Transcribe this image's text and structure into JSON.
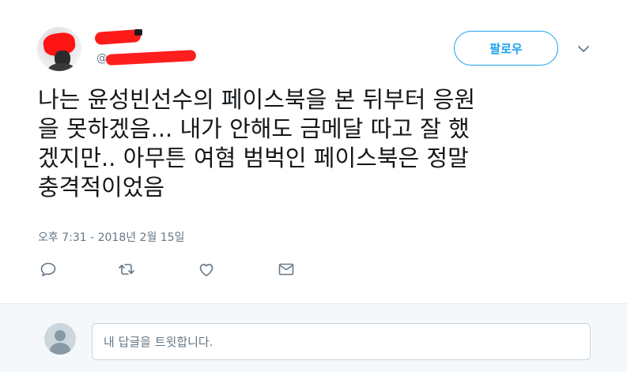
{
  "tweet": {
    "handle_prefix": "@g",
    "follow_label": "팔로우",
    "text": "나는 윤성빈선수의 페이스북을 본 뒤부터 응원\n을 못하겠음... 내가 안해도 금메달 따고 잘 했\n겠지만.. 아무튼 여혐 범벅인 페이스북은 정말\n충격적이었음",
    "timestamp": "오후 7:31 - 2018년 2월 15일",
    "colors": {
      "accent": "#1da1f2",
      "secondary_text": "#657786",
      "redaction": "#ff1a1a"
    },
    "icons": {
      "reply": "reply-icon",
      "retweet": "retweet-icon",
      "like": "heart-icon",
      "message": "envelope-icon",
      "more": "chevron-down-icon"
    }
  },
  "reply": {
    "placeholder": "내 답글을 트윗합니다."
  }
}
